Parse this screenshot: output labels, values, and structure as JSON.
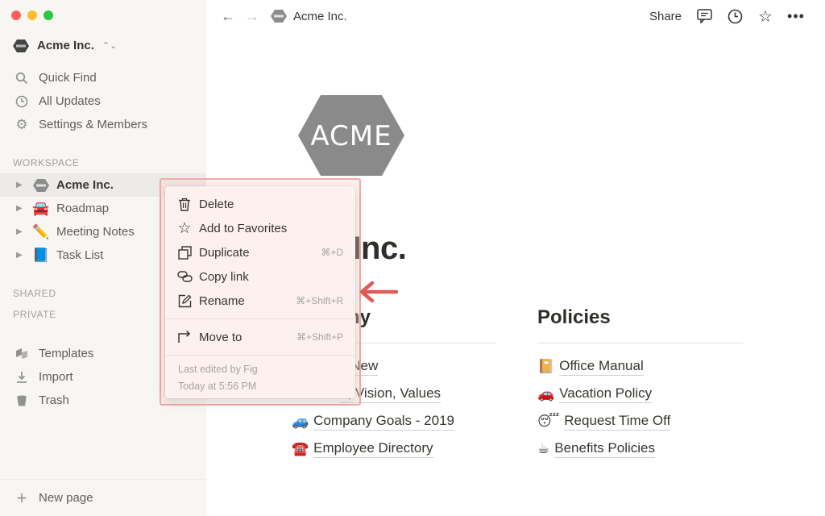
{
  "colors": {
    "sidebar_bg": "#f7f6f3",
    "menu_bg": "#fdf1f0",
    "highlight_border": "#f1aaa8",
    "arrow": "#e05a57"
  },
  "sidebar": {
    "workspace_name": "Acme Inc.",
    "nav": [
      {
        "label": "Quick Find",
        "icon": "search-icon"
      },
      {
        "label": "All Updates",
        "icon": "clock-icon"
      },
      {
        "label": "Settings & Members",
        "icon": "gear-icon"
      }
    ],
    "workspace_label": "WORKSPACE",
    "pages": [
      {
        "icon": "acme-logo-icon",
        "label": "Acme Inc."
      },
      {
        "icon": "car-emoji",
        "emoji": "🚘",
        "label": "Roadmap"
      },
      {
        "icon": "pencil-emoji",
        "emoji": "✏️",
        "label": "Meeting Notes"
      },
      {
        "icon": "book-emoji",
        "emoji": "📘",
        "label": "Task List"
      }
    ],
    "shared_label": "SHARED",
    "private_label": "PRIVATE",
    "bottom": [
      {
        "label": "Templates",
        "icon": "templates-icon"
      },
      {
        "label": "Import",
        "icon": "import-icon"
      },
      {
        "label": "Trash",
        "icon": "trash-icon"
      }
    ],
    "new_page": "New page"
  },
  "topbar": {
    "breadcrumb": "Acme Inc.",
    "share": "Share"
  },
  "page": {
    "logo_text": "ACME",
    "title": "me Inc.",
    "col1": {
      "heading": "ny",
      "items": [
        {
          "emoji": "",
          "label": "s New"
        },
        {
          "emoji": "",
          "label": "n, Vision, Values"
        },
        {
          "emoji": "🚙",
          "label": "Company Goals - 2019"
        },
        {
          "emoji": "☎️",
          "label": "Employee Directory"
        }
      ]
    },
    "col2": {
      "heading": "Policies",
      "items": [
        {
          "emoji": "📔",
          "label": "Office Manual"
        },
        {
          "emoji": "🚗",
          "label": "Vacation Policy"
        },
        {
          "emoji": "😴",
          "label": "Request Time Off"
        },
        {
          "emoji": "☕",
          "label": "Benefits Policies"
        }
      ]
    }
  },
  "context_menu": {
    "items": [
      {
        "label": "Delete",
        "icon": "trash-icon",
        "shortcut": ""
      },
      {
        "label": "Add to Favorites",
        "icon": "star-icon",
        "shortcut": ""
      },
      {
        "label": "Duplicate",
        "icon": "duplicate-icon",
        "shortcut": "⌘+D"
      },
      {
        "label": "Copy link",
        "icon": "link-icon",
        "shortcut": ""
      },
      {
        "label": "Rename",
        "icon": "rename-icon",
        "shortcut": "⌘+Shift+R"
      }
    ],
    "move_to": {
      "label": "Move to",
      "icon": "move-to-icon",
      "shortcut": "⌘+Shift+P"
    },
    "last_edited": "Last edited by Fig",
    "edited_time": "Today at 5:56 PM"
  }
}
